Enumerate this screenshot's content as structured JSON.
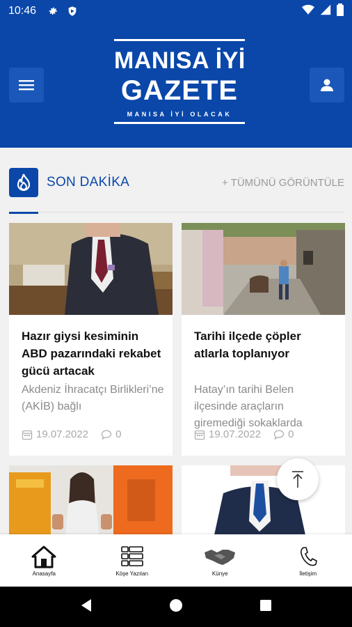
{
  "status_bar": {
    "time": "10:46"
  },
  "header": {
    "logo_line1": "MANISA İYİ",
    "logo_line2": "GAZETE",
    "logo_slogan": "MANISA İYİ OLACAK"
  },
  "section": {
    "title": "SON DAKİKA",
    "see_all": "+ TÜMÜNÜ GÖRÜNTÜLE"
  },
  "articles": [
    {
      "title": "Hazır giysi kesiminin ABD pazarındaki rekabet gücü artacak",
      "excerpt": "Akdeniz İhracatçı Birlikleri’ne (AKİB) bağlı",
      "date": "19.07.2022",
      "comments": "0"
    },
    {
      "title": "Tarihi ilçede çöpler atlarla toplanıyor",
      "excerpt": "Hatay’ın tarihi Belen ilçesinde araçların giremediği sokaklarda",
      "date": "19.07.2022",
      "comments": "0"
    },
    {
      "title": "",
      "excerpt": "",
      "date": "",
      "comments": ""
    },
    {
      "title": "",
      "excerpt": "",
      "date": "",
      "comments": ""
    }
  ],
  "bottom_nav": [
    {
      "label": "Anasayfa",
      "icon": "home-icon"
    },
    {
      "label": "Köşe Yazıları",
      "icon": "grid-icon"
    },
    {
      "label": "Künye",
      "icon": "handshake-icon"
    },
    {
      "label": "İletişim",
      "icon": "phone-icon"
    }
  ],
  "colors": {
    "brand": "#0a47a9",
    "muted": "#8a8a8a"
  }
}
